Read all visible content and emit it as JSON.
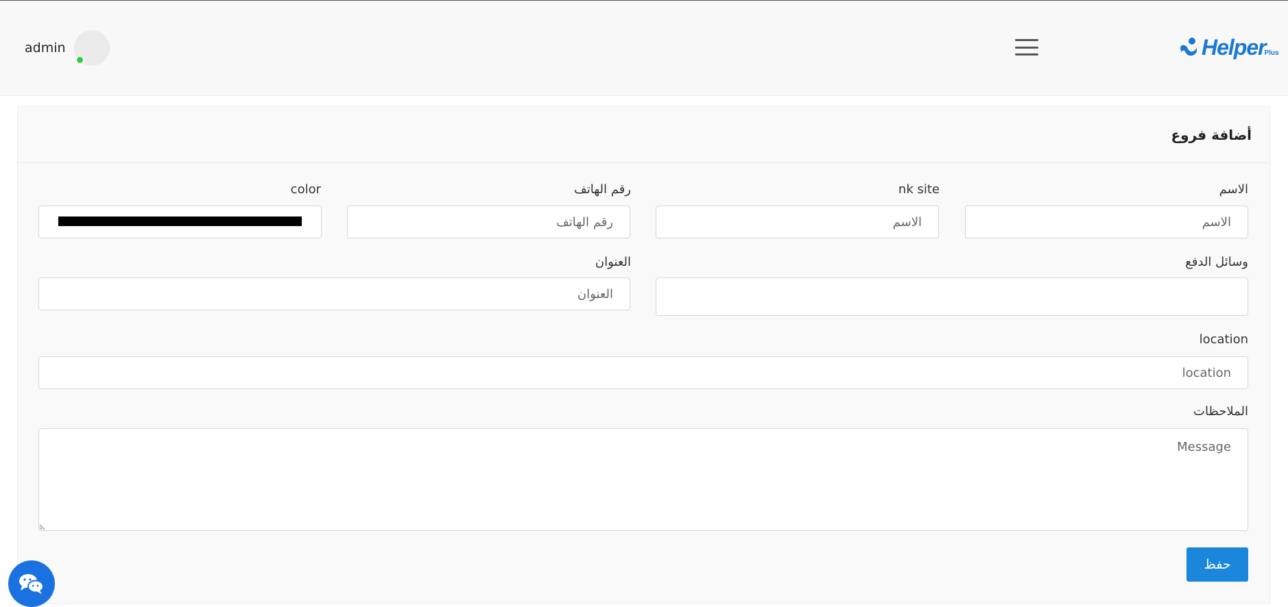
{
  "header": {
    "user_name": "admin",
    "logo_text": "Helper",
    "logo_suffix": "Plus"
  },
  "form": {
    "title": "أضافة فروع",
    "name_label": "الاسم",
    "name_placeholder": "الاسم",
    "site_label": "nk site",
    "site_placeholder": "الاسم",
    "phone_label": "رقم الهاتف",
    "phone_placeholder": "رقم الهاتف",
    "color_label": "color",
    "color_value": "#000000",
    "payment_label": "وسائل الدفع",
    "address_label": "العنوان",
    "address_placeholder": "العنوان",
    "location_label": "location",
    "location_placeholder": "location",
    "notes_label": "الملاحظات",
    "notes_placeholder": "Message",
    "save_label": "حفظ"
  },
  "colors": {
    "accent": "#1a86dc",
    "online": "#2ecc40",
    "chat": "#1a72e0"
  }
}
